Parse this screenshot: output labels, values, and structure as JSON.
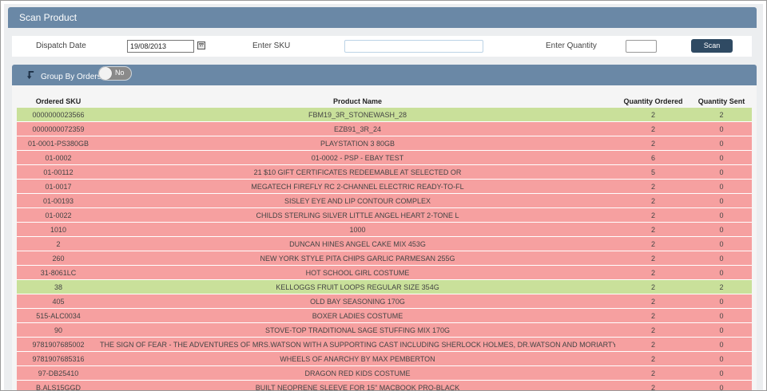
{
  "header": {
    "title": "Scan Product"
  },
  "form": {
    "dispatch_date_label": "Dispatch Date",
    "dispatch_date_value": "19/08/2013",
    "sku_label": "Enter SKU",
    "sku_value": "",
    "quantity_label": "Enter Quantity",
    "quantity_value": "",
    "scan_label": "Scan"
  },
  "group": {
    "label": "Group By Orders:",
    "toggle_text": "No"
  },
  "table": {
    "headers": [
      "Ordered SKU",
      "Product Name",
      "Quantity Ordered",
      "Quantity Sent"
    ],
    "rows": [
      {
        "sku": "0000000023566",
        "name": "FBM19_3R_STONEWASH_28",
        "ordered": "2",
        "sent": "2",
        "status": "green"
      },
      {
        "sku": "0000000072359",
        "name": "EZB91_3R_24",
        "ordered": "2",
        "sent": "0",
        "status": "red"
      },
      {
        "sku": "01-0001-PS380GB",
        "name": "PLAYSTATION 3 80GB",
        "ordered": "2",
        "sent": "0",
        "status": "red"
      },
      {
        "sku": "01-0002",
        "name": "01-0002 - PSP - EBAY TEST",
        "ordered": "6",
        "sent": "0",
        "status": "red"
      },
      {
        "sku": "01-00112",
        "name": "21 $10 GIFT CERTIFICATES REDEEMABLE AT SELECTED OR",
        "ordered": "5",
        "sent": "0",
        "status": "red"
      },
      {
        "sku": "01-0017",
        "name": "MEGATECH FIREFLY RC 2-CHANNEL ELECTRIC READY-TO-FL",
        "ordered": "2",
        "sent": "0",
        "status": "red"
      },
      {
        "sku": "01-00193",
        "name": "SISLEY EYE AND LIP CONTOUR COMPLEX",
        "ordered": "2",
        "sent": "0",
        "status": "red"
      },
      {
        "sku": "01-0022",
        "name": "CHILDS STERLING SILVER LITTLE ANGEL HEART 2-TONE L",
        "ordered": "2",
        "sent": "0",
        "status": "red"
      },
      {
        "sku": "1010",
        "name": "1000",
        "ordered": "2",
        "sent": "0",
        "status": "red"
      },
      {
        "sku": "2",
        "name": "DUNCAN HINES ANGEL CAKE MIX 453G",
        "ordered": "2",
        "sent": "0",
        "status": "red"
      },
      {
        "sku": "260",
        "name": "NEW YORK STYLE PITA CHIPS GARLIC PARMESAN 255G",
        "ordered": "2",
        "sent": "0",
        "status": "red"
      },
      {
        "sku": "31-8061LC",
        "name": "HOT SCHOOL GIRL COSTUME",
        "ordered": "2",
        "sent": "0",
        "status": "red"
      },
      {
        "sku": "38",
        "name": "KELLOGGS FRUIT LOOPS REGULAR SIZE 354G",
        "ordered": "2",
        "sent": "2",
        "status": "green"
      },
      {
        "sku": "405",
        "name": "OLD BAY SEASONING 170G",
        "ordered": "2",
        "sent": "0",
        "status": "red"
      },
      {
        "sku": "515-ALC0034",
        "name": "BOXER LADIES COSTUME",
        "ordered": "2",
        "sent": "0",
        "status": "red"
      },
      {
        "sku": "90",
        "name": "STOVE-TOP TRADITIONAL SAGE STUFFING MIX 170G",
        "ordered": "2",
        "sent": "0",
        "status": "red"
      },
      {
        "sku": "9781907685002",
        "name": "THE SIGN OF FEAR - THE ADVENTURES OF MRS.WATSON WITH A SUPPORTING CAST INCLUDING SHERLOCK HOLMES, DR.WATSON AND MORIARTY",
        "ordered": "2",
        "sent": "0",
        "status": "red"
      },
      {
        "sku": "9781907685316",
        "name": "WHEELS OF ANARCHY BY MAX PEMBERTON",
        "ordered": "2",
        "sent": "0",
        "status": "red"
      },
      {
        "sku": "97-DB25410",
        "name": "DRAGON RED KIDS COSTUME",
        "ordered": "2",
        "sent": "0",
        "status": "red"
      },
      {
        "sku": "B.ALS15GGD",
        "name": "BUILT NEOPRENE SLEEVE FOR 15\" MACBOOK PRO-BLACK",
        "ordered": "2",
        "sent": "0",
        "status": "red"
      },
      {
        "sku": "",
        "name": "",
        "ordered": "",
        "sent": "",
        "status": "red"
      }
    ]
  },
  "colors": {
    "header_bar": "#6a88a6",
    "scan_button": "#2f4a63",
    "row_pending": "#f6a0a0",
    "row_complete": "#c9e09a"
  }
}
